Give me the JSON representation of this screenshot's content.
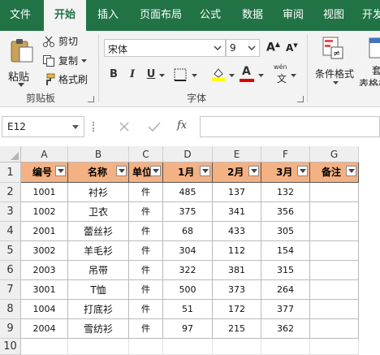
{
  "tabs": [
    {
      "label": "文件",
      "active": false
    },
    {
      "label": "开始",
      "active": true
    },
    {
      "label": "插入",
      "active": false
    },
    {
      "label": "页面布局",
      "active": false
    },
    {
      "label": "公式",
      "active": false
    },
    {
      "label": "数据",
      "active": false
    },
    {
      "label": "审阅",
      "active": false
    },
    {
      "label": "视图",
      "active": false
    },
    {
      "label": "开发",
      "active": false
    }
  ],
  "clipboard": {
    "paste_label": "粘贴",
    "cut_label": "剪切",
    "copy_label": "复制",
    "format_painter_label": "格式刷",
    "group_label": "剪贴板"
  },
  "font": {
    "font_name": "宋体",
    "font_size": "9",
    "bold": "B",
    "italic": "I",
    "underline": "U",
    "phonetic_label": "wén",
    "group_label": "字体"
  },
  "styles": {
    "conditional_format_label": "条件格式",
    "table_format_label_1": "套",
    "table_format_label_2": "表格格"
  },
  "formula_bar": {
    "name_box": "E12",
    "fx_label": "fx",
    "formula": ""
  },
  "sheet": {
    "columns": [
      "A",
      "B",
      "C",
      "D",
      "E",
      "F",
      "G"
    ],
    "row_numbers": [
      "1",
      "2",
      "3",
      "4",
      "5",
      "6",
      "7",
      "8",
      "9",
      "10"
    ],
    "headers": [
      "编号",
      "名称",
      "单位",
      "1月",
      "2月",
      "3月",
      "备注"
    ],
    "rows": [
      [
        "1001",
        "衬衫",
        "件",
        "485",
        "137",
        "132",
        ""
      ],
      [
        "1002",
        "卫衣",
        "件",
        "375",
        "341",
        "356",
        ""
      ],
      [
        "2001",
        "蕾丝衫",
        "件",
        "68",
        "433",
        "305",
        ""
      ],
      [
        "3002",
        "羊毛衫",
        "件",
        "304",
        "112",
        "154",
        ""
      ],
      [
        "2003",
        "吊带",
        "件",
        "322",
        "381",
        "315",
        ""
      ],
      [
        "3001",
        "T恤",
        "件",
        "500",
        "373",
        "264",
        ""
      ],
      [
        "1004",
        "打底衫",
        "件",
        "51",
        "172",
        "377",
        ""
      ],
      [
        "2004",
        "雪纺衫",
        "件",
        "97",
        "215",
        "362",
        ""
      ]
    ]
  },
  "colors": {
    "ribbon_accent": "#217346",
    "header_fill": "#f4b183",
    "font_color": "#e00000",
    "highlight_color": "#ffff00"
  }
}
